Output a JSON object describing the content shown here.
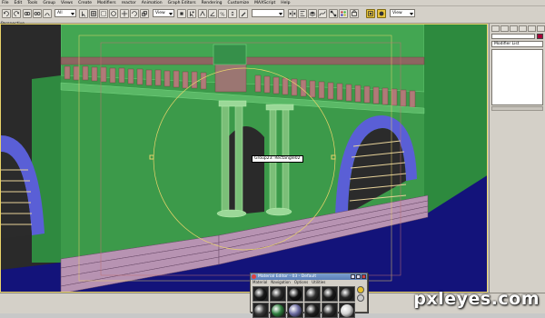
{
  "menu": {
    "items": [
      "File",
      "Edit",
      "Tools",
      "Group",
      "Views",
      "Create",
      "Modifiers",
      "reactor",
      "Animation",
      "Graph Editors",
      "Rendering",
      "Customize",
      "MAXScript",
      "Help"
    ]
  },
  "toolbar": {
    "selection_filter": "All",
    "ref_coord": "View",
    "named_selection": "",
    "render_preset": "View"
  },
  "viewport": {
    "label": "Perspective",
    "object_label": "Group23: Rectangle02"
  },
  "command_panel": {
    "modifier_list": "Modifier List"
  },
  "material_editor": {
    "title": "Material Editor - 03 - Default",
    "menu": [
      "Material",
      "Navigation",
      "Options",
      "Utilities"
    ],
    "slots": [
      "#1a1a1a",
      "#2a2a2a",
      "#101010",
      "#303030",
      "#1c1c1c",
      "#262626",
      "#3a3a3a",
      "#2f7d3e",
      "#6a6aa0",
      "#1f1f1f",
      "#2c2c2c",
      "#d0d0d0"
    ]
  },
  "colors": {
    "wall": "#3c9a4a",
    "floor": "#13137a",
    "arch": "#5a5fd6",
    "selection": "#e9d36a"
  },
  "watermark": "pxleyes.com"
}
